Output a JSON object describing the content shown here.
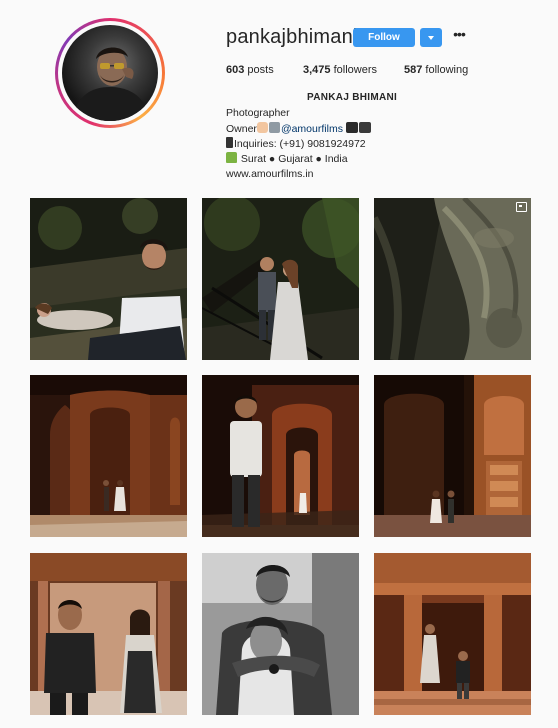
{
  "profile": {
    "username": "pankajbhimani",
    "follow_label": "Follow",
    "more_label": "•••",
    "full_name": "PANKAJ BHIMANI",
    "stats": {
      "posts_value": "603",
      "posts_label": "posts",
      "followers_value": "3,475",
      "followers_label": "followers",
      "following_value": "587",
      "following_label": "following"
    },
    "bio": {
      "line1": "Photographer",
      "line2_prefix": "Owner",
      "line2_mention": "@amourfilms",
      "line3": "Inquiries: (+91) 9081924972",
      "line4": "Surat ● Gujarat ● India",
      "website": "www.amourfilms.in"
    }
  },
  "colors": {
    "accent": "#3897f0",
    "link": "#003569",
    "background": "#fafafa",
    "text": "#262626"
  },
  "icons": [
    "chevron-down-icon",
    "more-options-icon",
    "multiple-photos-icon"
  ],
  "posts": [
    {
      "scene": "couple-lying-forest"
    },
    {
      "scene": "couple-standing-forest-stairs"
    },
    {
      "scene": "rock-texture",
      "multiple": true
    },
    {
      "scene": "couple-arches-warm"
    },
    {
      "scene": "man-archway"
    },
    {
      "scene": "couple-courtyard-carved-wall"
    },
    {
      "scene": "couple-pillared-hall"
    },
    {
      "scene": "couple-embrace-bw"
    },
    {
      "scene": "couple-red-sandstone-hall"
    }
  ]
}
